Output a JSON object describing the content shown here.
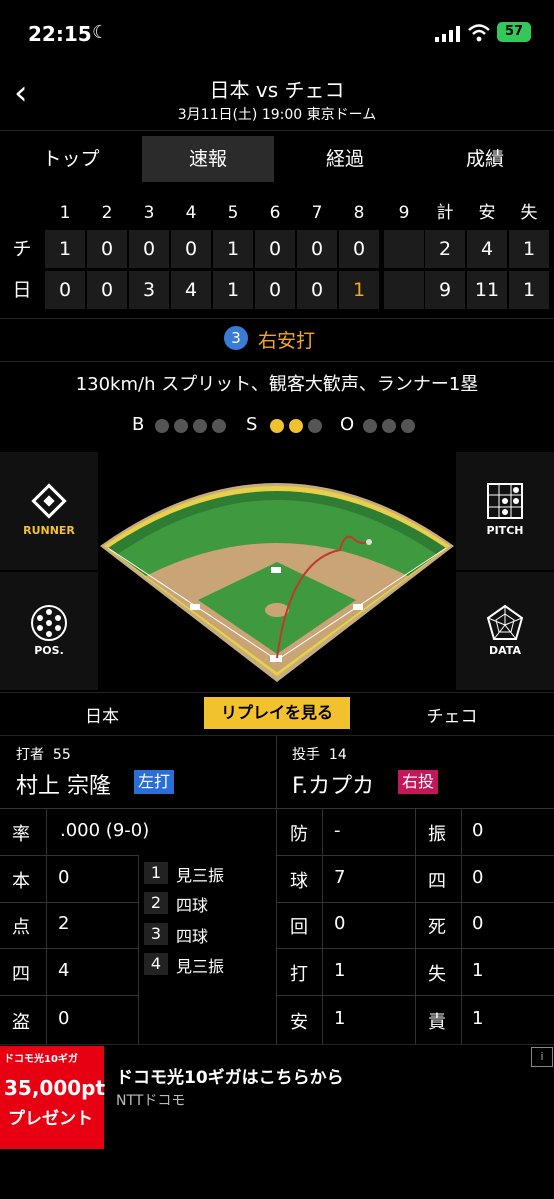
{
  "status": {
    "time": "22:15",
    "battery": "57"
  },
  "header": {
    "title": "日本 vs チェコ",
    "subtitle": "3月11日(土) 19:00 東京ドーム"
  },
  "tabs": [
    "トップ",
    "速報",
    "経過",
    "成績"
  ],
  "scoreboard": {
    "columns": [
      "1",
      "2",
      "3",
      "4",
      "5",
      "6",
      "7",
      "8",
      "9",
      "計",
      "安",
      "失"
    ],
    "rows": [
      {
        "team": "チ",
        "cells": [
          "1",
          "0",
          "0",
          "0",
          "1",
          "0",
          "0",
          "0",
          "",
          "2",
          "4",
          "1"
        ]
      },
      {
        "team": "日",
        "cells": [
          "0",
          "0",
          "3",
          "4",
          "1",
          "0",
          "0",
          "1",
          "",
          "9",
          "11",
          "1"
        ]
      }
    ]
  },
  "play": {
    "number": "3",
    "result": "右安打",
    "description": "130km/h スプリット、観客大歓声、ランナー1塁"
  },
  "count": {
    "b_label": "B",
    "s_label": "S",
    "o_label": "O",
    "balls": 0,
    "strikes": 2,
    "outs": 0
  },
  "buttons": {
    "runner": "RUNNER",
    "pitch": "PITCH",
    "pos": "POS.",
    "data": "DATA"
  },
  "teambar": {
    "left": "日本",
    "replay": "リプレイを見る",
    "right": "チェコ"
  },
  "batter": {
    "label": "打者",
    "number": "55",
    "name": "村上 宗隆",
    "hand": "左打"
  },
  "pitcher": {
    "label": "投手",
    "number": "14",
    "name": "F.カプカ",
    "hand": "右投"
  },
  "batter_stats": [
    {
      "k": "率",
      "v": ".000 (9-0)"
    },
    {
      "k": "本",
      "v": "0"
    },
    {
      "k": "点",
      "v": "2"
    },
    {
      "k": "四",
      "v": "4"
    },
    {
      "k": "盗",
      "v": "0"
    }
  ],
  "at_bats": [
    {
      "n": "1",
      "r": "見三振"
    },
    {
      "n": "2",
      "r": "四球"
    },
    {
      "n": "3",
      "r": "四球"
    },
    {
      "n": "4",
      "r": "見三振"
    }
  ],
  "pitcher_stats_left": [
    {
      "k": "防",
      "v": "-"
    },
    {
      "k": "球",
      "v": "7"
    },
    {
      "k": "回",
      "v": "0"
    },
    {
      "k": "打",
      "v": "1"
    },
    {
      "k": "安",
      "v": "1"
    }
  ],
  "pitcher_stats_right": [
    {
      "k": "振",
      "v": "0"
    },
    {
      "k": "四",
      "v": "0"
    },
    {
      "k": "死",
      "v": "0"
    },
    {
      "k": "失",
      "v": "1"
    },
    {
      "k": "責",
      "v": "1"
    }
  ],
  "ad": {
    "title": "ドコモ光10ギガはこちらから",
    "sponsor": "NTTドコモ",
    "img_line1": "ドコモ光10ギガ",
    "img_line2": "35,000pt",
    "img_line3": "プレゼント"
  },
  "colors": {
    "accent": "#f2c12e",
    "orange": "#f5a623",
    "blue_tag": "#2a6fd6",
    "red_tag": "#c2185b"
  }
}
